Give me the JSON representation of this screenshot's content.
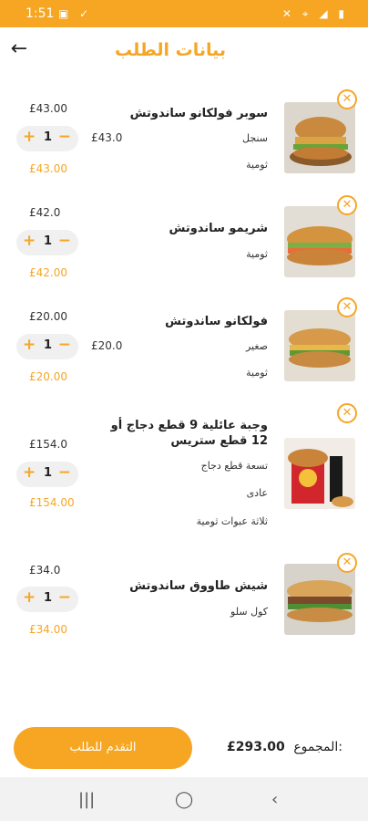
{
  "status": {
    "time": "1:51"
  },
  "header": {
    "title": "بيانات الطلب"
  },
  "items": [
    {
      "name": "سوبر فولكانو ساندوتش",
      "options": [
        "سنجل",
        "ثومية"
      ],
      "unit_price": "£43.00",
      "mid_price": "£43.0",
      "qty": "1",
      "total": "£43.00"
    },
    {
      "name": "شريمو ساندوتش",
      "options": [
        "ثومية"
      ],
      "unit_price": "£42.0",
      "qty": "1",
      "total": "£42.00"
    },
    {
      "name": "فولكانو ساندوتش",
      "options": [
        "صغير",
        "ثومية"
      ],
      "unit_price": "£20.00",
      "mid_price": "£20.0",
      "qty": "1",
      "total": "£20.00"
    },
    {
      "name": "وجبة عائلية 9 قطع دجاج أو 12 قطع ستريس",
      "options": [
        "تسعة قطع دجاج",
        "عادى",
        "ثلاثة عبوات ثومية"
      ],
      "unit_price": "£154.0",
      "qty": "1",
      "total": "£154.00"
    },
    {
      "name": "شيش طاووق ساندوتش",
      "options": [
        "كول سلو"
      ],
      "unit_price": "£34.0",
      "qty": "1",
      "total": "£34.00"
    }
  ],
  "footer": {
    "checkout_label": "التقدم للطلب",
    "sum_label": "المجموع:",
    "sum_value": "£293.00"
  },
  "colors": {
    "accent": "#f6a623"
  }
}
